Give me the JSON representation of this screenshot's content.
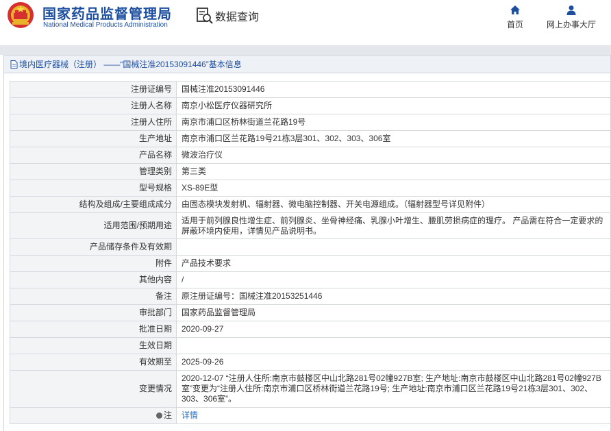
{
  "header": {
    "logo_icon": "national-emblem-icon",
    "brand_cn": "国家药品监督管理局",
    "brand_en": "National Medical Products Administration",
    "data_query_label": "数据查询",
    "nav_home_label": "首页",
    "nav_office_label": "网上办事大厅"
  },
  "panel": {
    "title": "境内医疗器械（注册） ——“国械注准20153091446”基本信息"
  },
  "rows": [
    {
      "label": "注册证编号",
      "value": "国械注准20153091446"
    },
    {
      "label": "注册人名称",
      "value": "南京小松医疗仪器研究所"
    },
    {
      "label": "注册人住所",
      "value": "南京市浦口区桥林街道兰花路19号"
    },
    {
      "label": "生产地址",
      "value": "南京市浦口区兰花路19号21栋3层301、302、303、306室"
    },
    {
      "label": "产品名称",
      "value": "微波治疗仪"
    },
    {
      "label": "管理类别",
      "value": "第三类"
    },
    {
      "label": "型号规格",
      "value": "XS-89E型"
    },
    {
      "label": "结构及组成/主要组成成分",
      "value": "由固态模块发射机、辐射器、微电脑控制器、开关电源组成。（辐射器型号详见附件）"
    },
    {
      "label": "适用范围/预期用途",
      "value": "适用于前列腺良性增生症、前列腺炎、坐骨神经痛、乳腺小叶增生、腰肌劳损病症的理疗。 产品需在符合一定要求的屏蔽环境内使用，详情见产品说明书。"
    },
    {
      "label": "产品储存条件及有效期",
      "value": ""
    },
    {
      "label": "附件",
      "value": "产品技术要求"
    },
    {
      "label": "其他内容",
      "value": "/"
    },
    {
      "label": "备注",
      "value": "原注册证编号：国械注准20153251446"
    },
    {
      "label": "审批部门",
      "value": "国家药品监督管理局"
    },
    {
      "label": "批准日期",
      "value": "2020-09-27"
    },
    {
      "label": "生效日期",
      "value": ""
    },
    {
      "label": "有效期至",
      "value": "2025-09-26"
    },
    {
      "label": "变更情况",
      "value": "2020-12-07 “注册人住所:南京市鼓楼区中山北路281号02幢927B室; 生产地址:南京市鼓楼区中山北路281号02幢927B室”变更为“注册人住所:南京市浦口区桥林街道兰花路19号; 生产地址:南京市浦口区兰花路19号21栋3层301、302、303、306室”。"
    },
    {
      "label": "注",
      "value": "详情",
      "icon": "info-dot-icon"
    }
  ]
}
